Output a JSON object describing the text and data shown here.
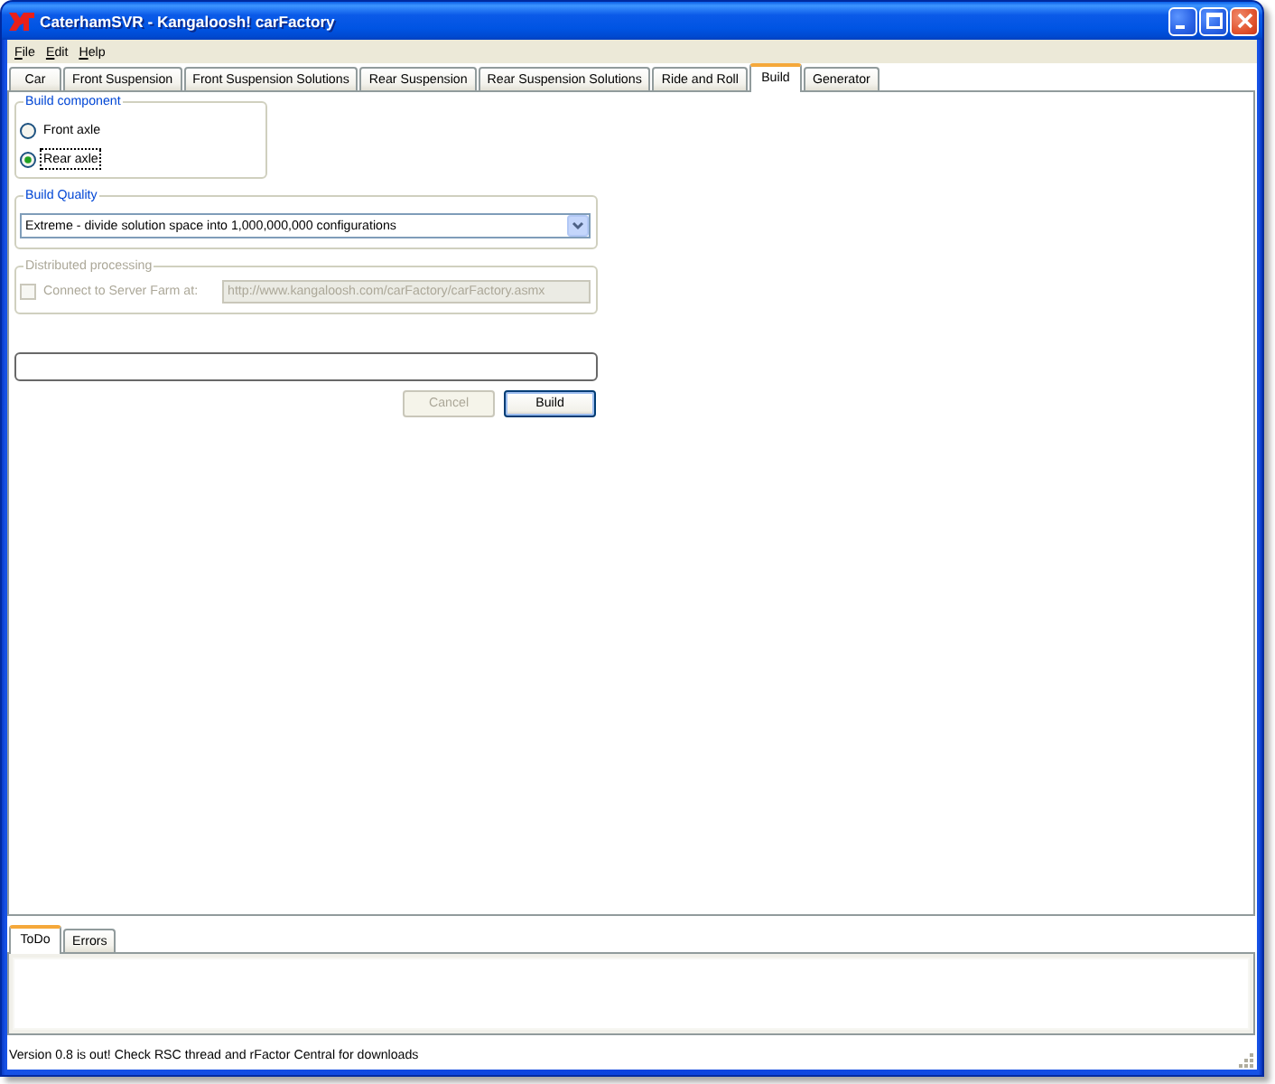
{
  "window": {
    "title": "CaterhamSVR - Kangaloosh! carFactory"
  },
  "menu": [
    "File",
    "Edit",
    "Help"
  ],
  "tabs": [
    {
      "label": "Car",
      "selected": false
    },
    {
      "label": "Front Suspension",
      "selected": false
    },
    {
      "label": "Front Suspension Solutions",
      "selected": false
    },
    {
      "label": "Rear Suspension",
      "selected": false
    },
    {
      "label": "Rear Suspension Solutions",
      "selected": false
    },
    {
      "label": "Ride and Roll",
      "selected": false
    },
    {
      "label": "Build",
      "selected": true
    },
    {
      "label": "Generator",
      "selected": false
    }
  ],
  "build_component": {
    "title": "Build component",
    "options": [
      {
        "label": "Front axle",
        "selected": false,
        "focused": false
      },
      {
        "label": "Rear axle",
        "selected": true,
        "focused": true
      }
    ]
  },
  "build_quality": {
    "title": "Build Quality",
    "value": "Extreme - divide solution space into 1,000,000,000 configurations"
  },
  "distributed_processing": {
    "title": "Distributed processing",
    "disabled": true,
    "checkbox": {
      "label": "Connect to Server Farm at:",
      "checked": false
    },
    "server_url": {
      "value": "http://www.kangaloosh.com/carFactory/carFactory.asmx"
    }
  },
  "progress": {
    "level": 0
  },
  "buttons": [
    {
      "label": "Cancel",
      "disabled": true,
      "default": false
    },
    {
      "label": "Build",
      "disabled": false,
      "default": true
    }
  ],
  "output_tabs": [
    {
      "label": "ToDo",
      "selected": true
    },
    {
      "label": "Errors",
      "selected": false
    }
  ],
  "status_bar": {
    "text": "Version 0.8 is out! Check RSC thread and rFactor Central for downloads"
  }
}
